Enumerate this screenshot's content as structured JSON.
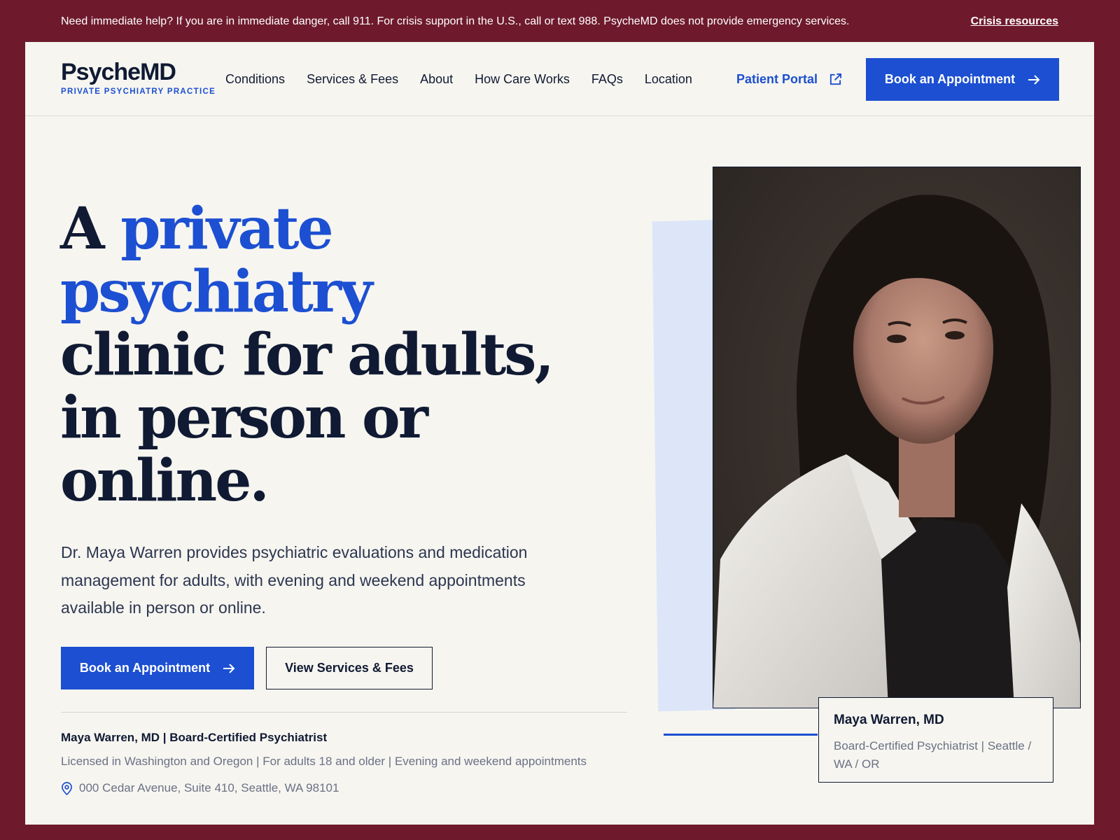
{
  "crisis_bar": {
    "message": "Need immediate help? If you are in immediate danger, call 911. For crisis support in the U.S., call or text 988. PsycheMD does not provide emergency services.",
    "link": "Crisis resources"
  },
  "header": {
    "logo_name": "PsycheMD",
    "logo_tagline": "PRIVATE PSYCHIATRY PRACTICE",
    "nav": [
      "Conditions",
      "Services & Fees",
      "About",
      "How Care Works",
      "FAQs",
      "Location"
    ],
    "portal": "Patient Portal",
    "cta": "Book an Appointment"
  },
  "hero": {
    "headline_lead": "A",
    "headline_accent_1": "private",
    "headline_accent_2": "psychiatry",
    "headline_line_3": "clinic for adults,",
    "headline_line_4": "in person or",
    "headline_line_5": "online.",
    "lead": "Dr. Maya Warren provides psychiatric evaluations and medication management for adults, with evening and weekend appointments available in person or online.",
    "primary_cta": "Book an Appointment",
    "secondary_cta": "View Services & Fees"
  },
  "credentials": {
    "title": "Maya Warren, MD | Board-Certified Psychiatrist",
    "details": "Licensed in Washington and Oregon | For adults 18 and older | Evening and weekend appointments",
    "address": "000 Cedar Avenue, Suite 410, Seattle, WA 98101"
  },
  "photo_caption": {
    "name": "Maya Warren, MD",
    "role": "Board-Certified Psychiatrist | Seattle / WA / OR"
  },
  "colors": {
    "brand_blue": "#1c4fd1",
    "crisis_bg": "#6e1a2c",
    "page_bg": "#f6f5f0",
    "ink": "#101a33"
  },
  "icons": {
    "portal": "external-link-icon",
    "cta": "arrow-right-icon",
    "address": "location-pin-icon"
  }
}
